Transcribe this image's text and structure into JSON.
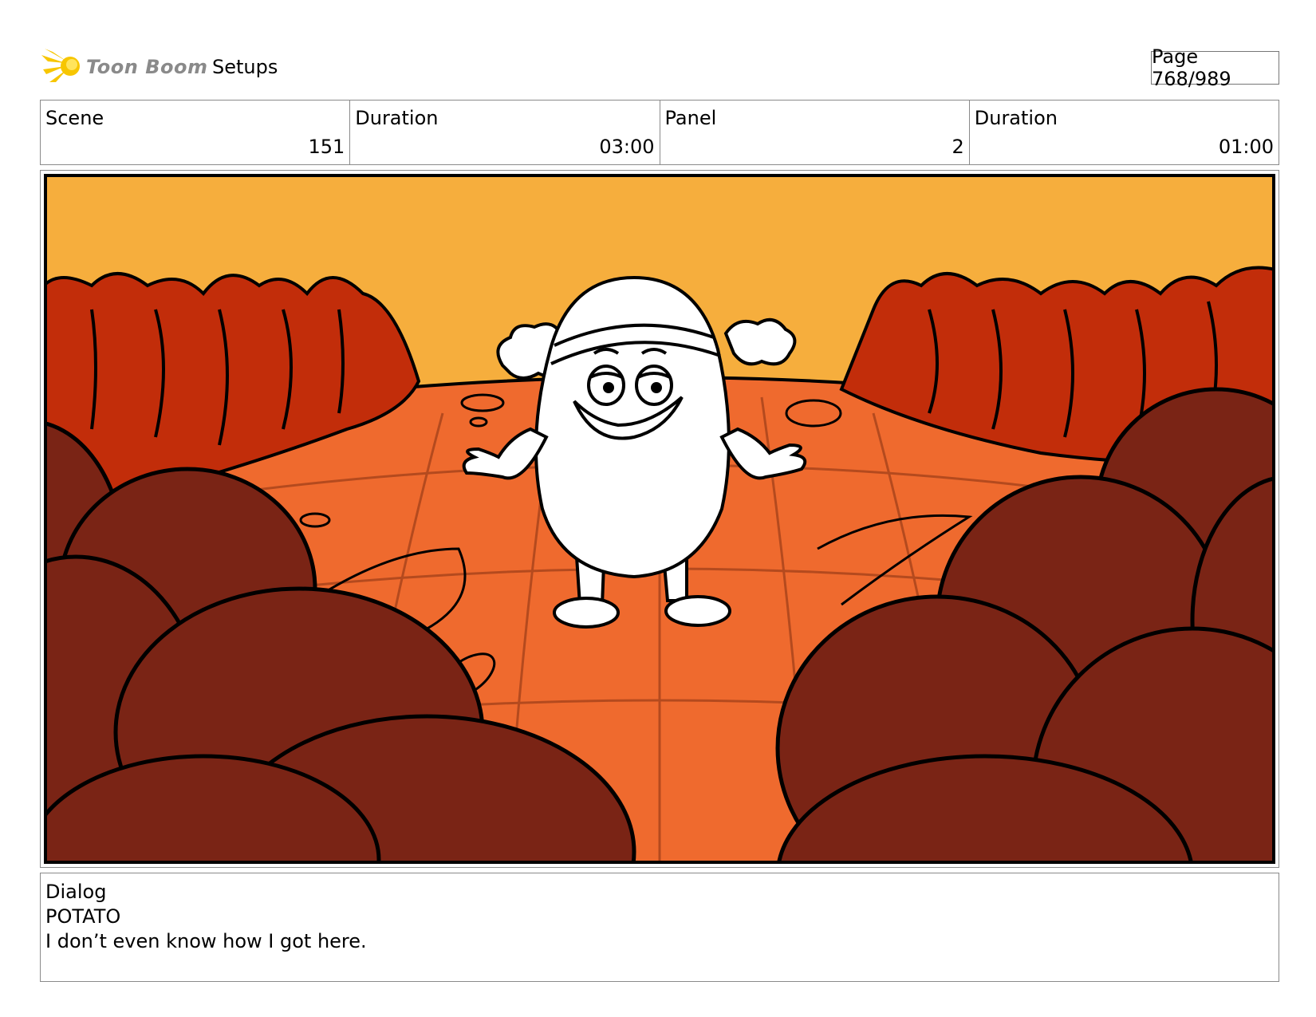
{
  "header": {
    "logo_text": "Toon Boom",
    "section_title": "Setups",
    "page_label": "Page 768/989"
  },
  "info": {
    "scene_label": "Scene",
    "scene_value": "151",
    "scene_duration_label": "Duration",
    "scene_duration_value": "03:00",
    "panel_label": "Panel",
    "panel_value": "2",
    "panel_duration_label": "Duration",
    "panel_duration_value": "01:00"
  },
  "dialog": {
    "label": "Dialog",
    "character": "POTATO",
    "line": "I don’t even know how I got here."
  },
  "colors": {
    "sky": "#f6ae3d",
    "ground": "#ef6a2e",
    "bushes": "#c22d0a",
    "rocks": "#7a2415",
    "outline": "#000000"
  }
}
